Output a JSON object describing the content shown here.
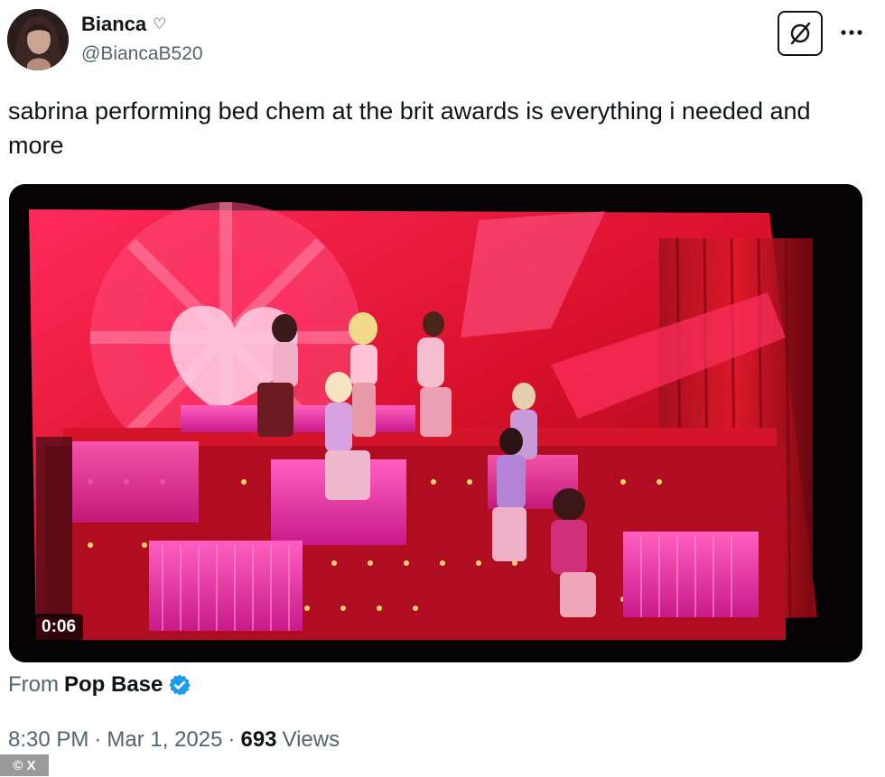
{
  "author": {
    "display_name": "Bianca",
    "name_glyph": "♡",
    "handle": "@BiancaB520"
  },
  "actions": {
    "grok_icon": "slashed-circle-icon",
    "more_icon": "more-horizontal-icon"
  },
  "tweet": {
    "text": "sabrina performing bed chem at the brit awards is everything i needed and more"
  },
  "media": {
    "duration": "0:06"
  },
  "source": {
    "prefix": "From",
    "name": "Pop Base",
    "verified_color": "#1d9bf0"
  },
  "meta": {
    "time": "8:30 PM",
    "separator": "·",
    "date": "Mar 1, 2025",
    "views_count": "693",
    "views_label": "Views"
  },
  "watermark": {
    "text": "© X"
  },
  "colors": {
    "text_primary": "#0f1419",
    "text_secondary": "#536471",
    "stage_red": "#e0102a",
    "stage_pink": "#ff4fb0"
  }
}
